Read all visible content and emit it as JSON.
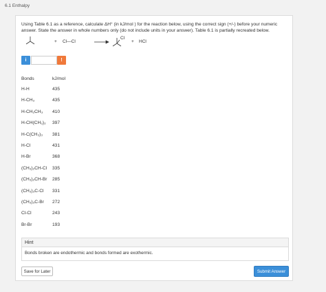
{
  "breadcrumb": "6.1 Enthalpy",
  "question": "Using Table 6.1 as a reference, calculate ΔH° (in kJ/mol ) for the reaction below, using the correct sign (+/-) before your numeric answer. State the answer in whole numbers only (do not include units in your answer). Table 6.1 is partially recreated below.",
  "reaction": {
    "plus1": "+",
    "reagent": "Cl—Cl",
    "product_label": "Cl",
    "plus2": "+",
    "byproduct": "HCl"
  },
  "answer": {
    "info_icon_glyph": "i",
    "value": "",
    "placeholder": "",
    "warning_icon_glyph": "!"
  },
  "table": {
    "headers": [
      "Bonds",
      "kJ/mol"
    ],
    "rows": [
      {
        "bond": "H-H",
        "value": "435"
      },
      {
        "bond": "H-CH₃",
        "value": "435"
      },
      {
        "bond": "H-CH₂CH₃",
        "value": "410"
      },
      {
        "bond": "H-CH(CH₃)₂",
        "value": "397"
      },
      {
        "bond": "H-C(CH₃)₃",
        "value": "381"
      },
      {
        "bond": "H-Cl",
        "value": "431"
      },
      {
        "bond": "H-Br",
        "value": "368"
      },
      {
        "bond": "(CH₃)₂CH-Cl",
        "value": "335"
      },
      {
        "bond": "(CH₃)₂CH-Br",
        "value": "285"
      },
      {
        "bond": "(CH₃)₃C-Cl",
        "value": "331"
      },
      {
        "bond": "(CH₃)₃C-Br",
        "value": "272"
      },
      {
        "bond": "Cl-Cl",
        "value": "243"
      },
      {
        "bond": "Br-Br",
        "value": "193"
      }
    ]
  },
  "hint": {
    "title": "Hint",
    "text": "Bonds broken are endothermic and bonds formed are exothermic."
  },
  "buttons": {
    "save": "Save for Later",
    "submit": "Submit Answer"
  },
  "colors": {
    "accent": "#3b8fd9",
    "warning": "#f0793a"
  },
  "icons": {
    "info": "info-icon",
    "warning": "warning-icon",
    "arrow": "reaction-arrow-icon"
  }
}
